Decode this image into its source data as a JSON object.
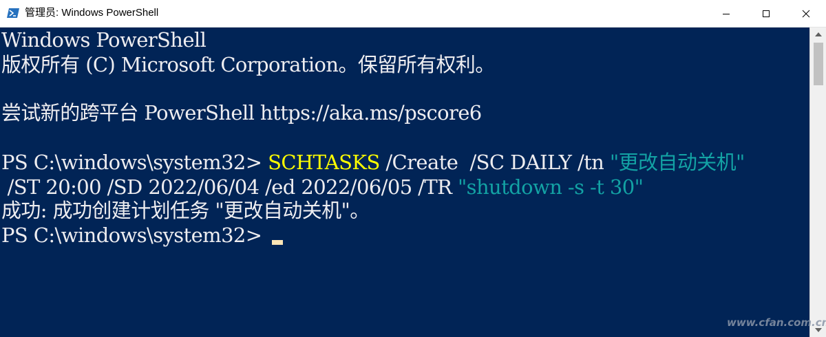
{
  "window": {
    "title": "管理员: Windows PowerShell",
    "icons": {
      "app": "powershell-icon",
      "minimize": "minimize-icon",
      "maximize": "maximize-icon",
      "close": "close-icon"
    }
  },
  "console": {
    "background": "#012456",
    "text_color": "#eeedf0",
    "lines": {
      "banner_title": "Windows PowerShell",
      "copyright": "版权所有 (C) Microsoft Corporation。保留所有权利。",
      "try_new": "尝试新的跨平台 PowerShell https://aka.ms/pscore6",
      "prompt1": "PS C:\\windows\\system32> ",
      "command_name": "SCHTASKS",
      "command_args1": " /Create  /SC DAILY /tn ",
      "command_tn_value": "\"更改自动关机\"",
      "command_args2": " /ST 20:00 /SD 2022/06/04 /ed 2022/06/05 /TR ",
      "command_tr_value": "\"shutdown -s -t 30\"",
      "result": "成功: 成功创建计划任务 \"更改自动关机\"。",
      "prompt2": "PS C:\\windows\\system32> "
    },
    "colors": {
      "command": "#ffff00",
      "string": "#13a2a4",
      "cursor": "#fce5b6"
    }
  },
  "watermark": "www.cfan.com.cn"
}
